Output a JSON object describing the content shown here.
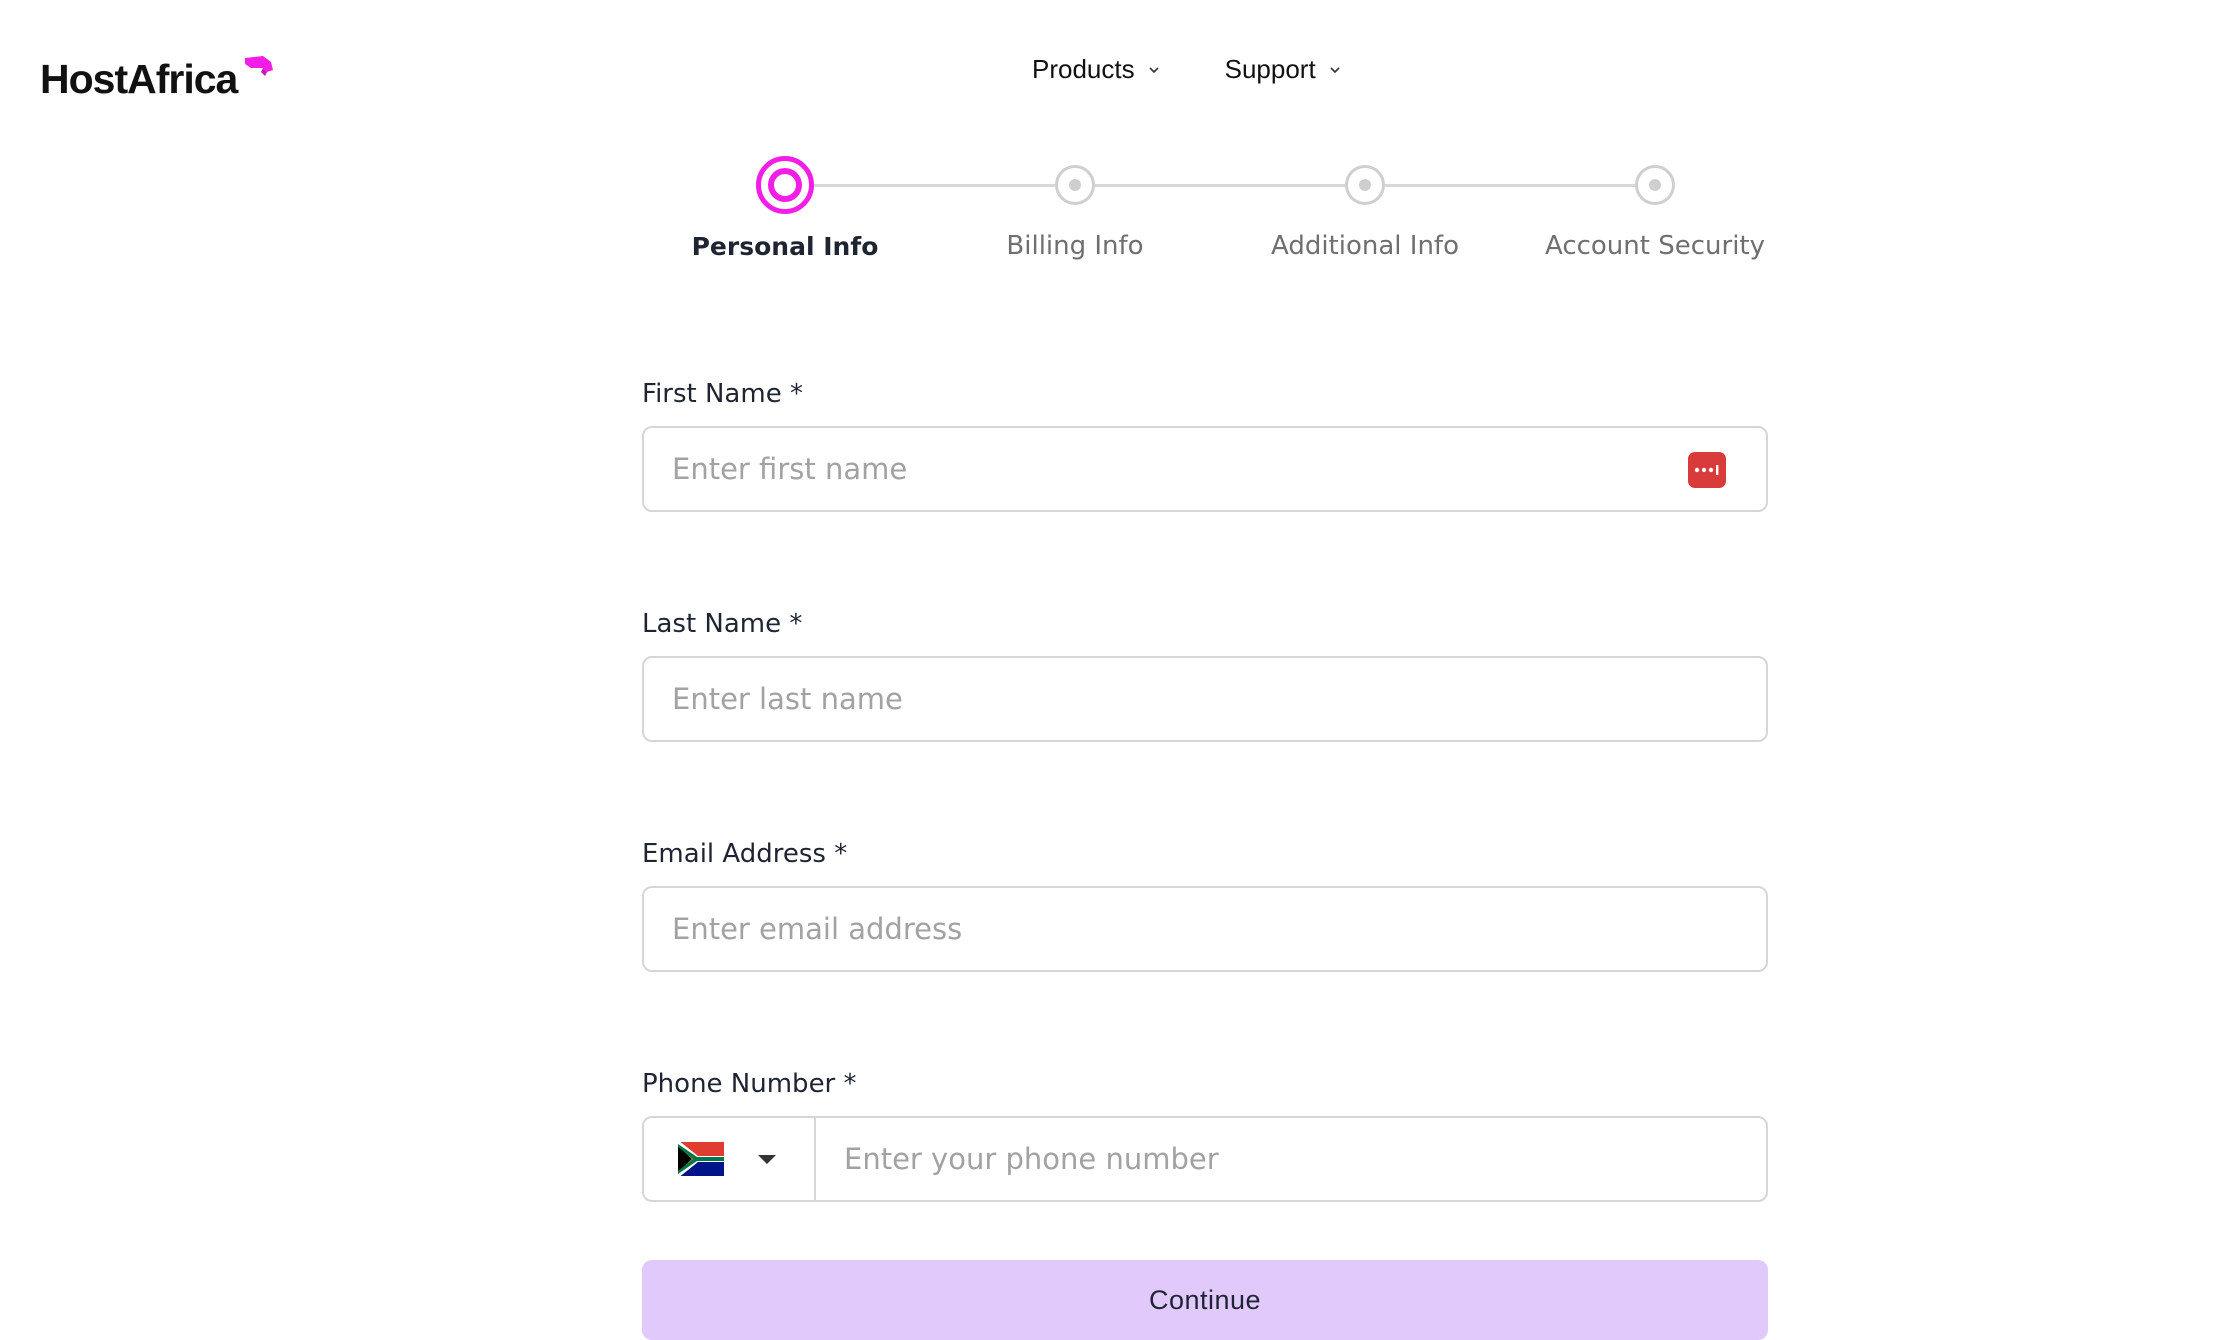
{
  "brand": {
    "name": "HostAfrica",
    "accent_color": "#f21ee8"
  },
  "nav": {
    "items": [
      {
        "label": "Products",
        "icon": "chevron-down-icon"
      },
      {
        "label": "Support",
        "icon": "chevron-down-icon"
      }
    ]
  },
  "stepper": {
    "current_step": 1,
    "steps": [
      {
        "label": "Personal Info",
        "state": "active"
      },
      {
        "label": "Billing Info",
        "state": "pending"
      },
      {
        "label": "Additional Info",
        "state": "pending"
      },
      {
        "label": "Account Security",
        "state": "pending"
      }
    ]
  },
  "form": {
    "first_name": {
      "label": "First Name *",
      "placeholder": "Enter first name",
      "value": "",
      "icon": "password-manager-icon"
    },
    "last_name": {
      "label": "Last Name *",
      "placeholder": "Enter last name",
      "value": ""
    },
    "email": {
      "label": "Email Address *",
      "placeholder": "Enter email address",
      "value": ""
    },
    "phone": {
      "label": "Phone Number *",
      "placeholder": "Enter your phone number",
      "value": "",
      "country_flag": "south-africa-flag-icon"
    },
    "submit_label": "Continue",
    "submit_color": "#e1c9fb"
  }
}
